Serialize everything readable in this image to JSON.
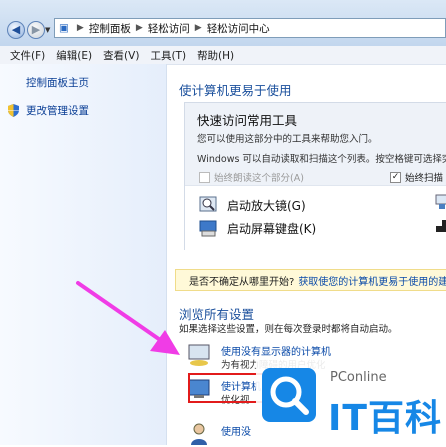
{
  "address_bar": {
    "crumbs": [
      "控制面板",
      "轻松访问",
      "轻松访问中心"
    ]
  },
  "menu": [
    "文件(F)",
    "编辑(E)",
    "查看(V)",
    "工具(T)",
    "帮助(H)"
  ],
  "sidebar": {
    "home": "控制面板主页",
    "admin": "更改管理设置"
  },
  "main": {
    "heading": "使计算机更易于使用",
    "panel": {
      "title": "快速访问常用工具",
      "desc1": "您可以使用这部分中的工具来帮助您入门。",
      "desc2": "Windows 可以自动读取和扫描这个列表。按空格键可选择突出",
      "chk_read": "始终朗读这个部分(A)",
      "chk_scan": "始终扫描",
      "tool_magnifier": "启动放大镜(G)",
      "tool_keyboard": "启动屏幕键盘(K)"
    },
    "tip": {
      "text": "是否不确定从哪里开始?",
      "link": "获取使您的计算机更易于使用的建议"
    },
    "browse": {
      "heading": "浏览所有设置",
      "desc": "如果选择这些设置，则在每次登录时都将自动启动。",
      "item1": "使用没有显示器的计算机",
      "item1_sub": "为有视力障碍的用户优化",
      "item2": "使计算机",
      "item2_sub": "优化视",
      "item3": "使用没"
    }
  },
  "watermark": {
    "brand": "PConline",
    "text": "IT百科"
  },
  "colors": {
    "arrow": "#f03ce6",
    "highlight": "#e21b1b",
    "link": "#0a4aa8"
  }
}
